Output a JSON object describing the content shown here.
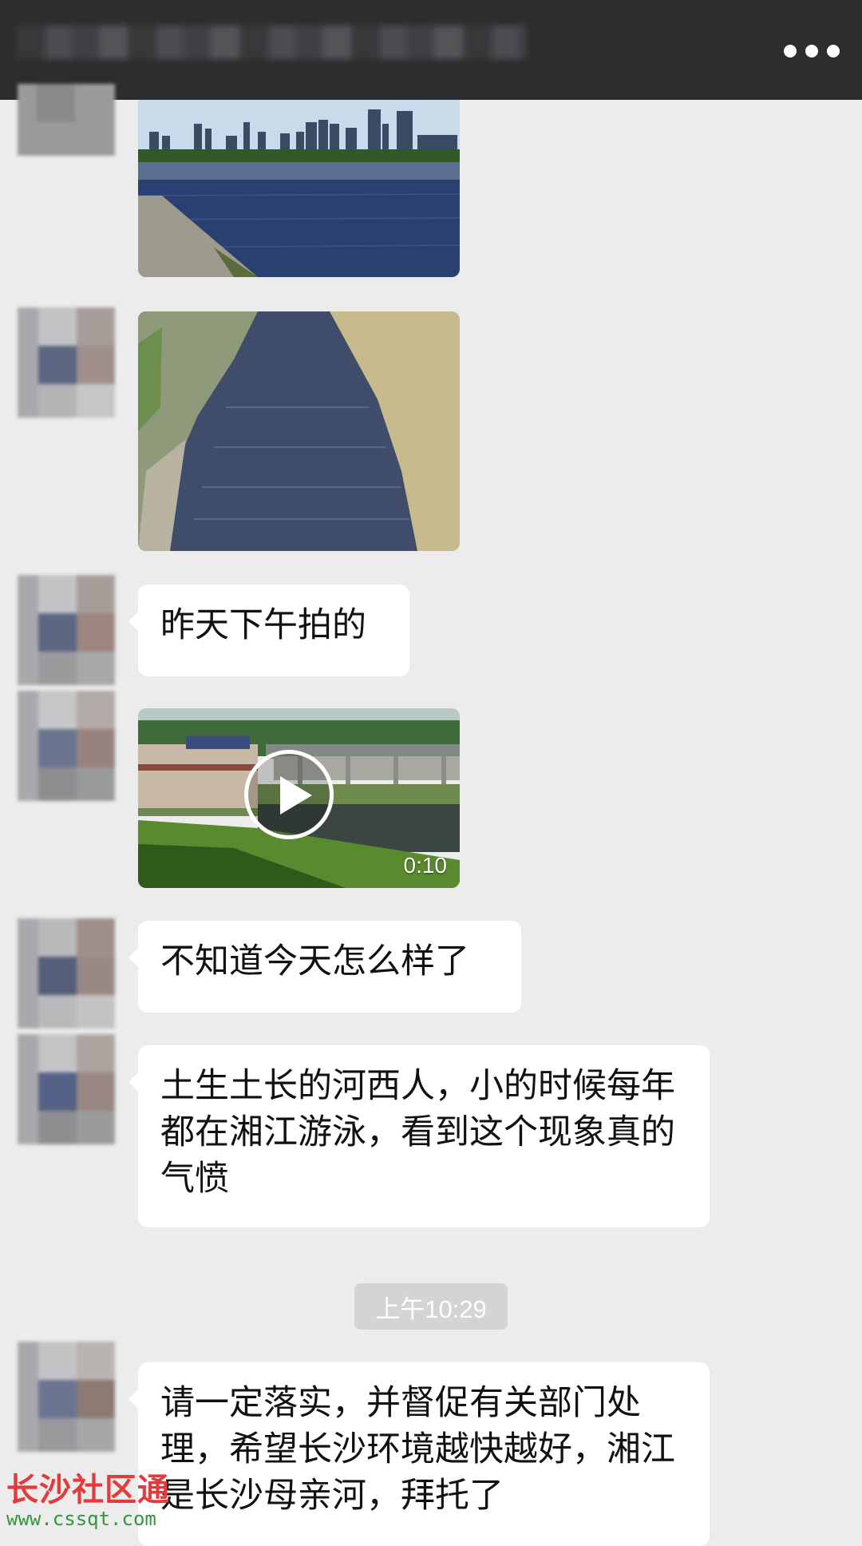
{
  "header": {
    "menu_icon": "more-dots-icon"
  },
  "messages": [
    {
      "type": "image",
      "description_icon": "image"
    },
    {
      "type": "image",
      "description_icon": "image"
    },
    {
      "type": "text",
      "text": "昨天下午拍的"
    },
    {
      "type": "video",
      "duration": "0:10"
    },
    {
      "type": "text",
      "text": "不知道今天怎么样了"
    },
    {
      "type": "text",
      "text": "土生土长的河西人，小的时候每年都在湘江游泳，看到这个现象真的气愤"
    },
    {
      "type": "text",
      "text": "请一定落实，并督促有关部门处理，希望长沙环境越快越好，湘江是长沙母亲河，拜托了"
    }
  ],
  "timestamp": "上午10:29",
  "watermark": {
    "title": "长沙社区通",
    "url": "www.cssqt.com"
  },
  "colors": {
    "header_bg": "#2d2d2f",
    "chat_bg": "#ececec",
    "bubble_bg": "#ffffff",
    "watermark_red": "#e33b3b",
    "watermark_green": "#2e9a3a"
  }
}
